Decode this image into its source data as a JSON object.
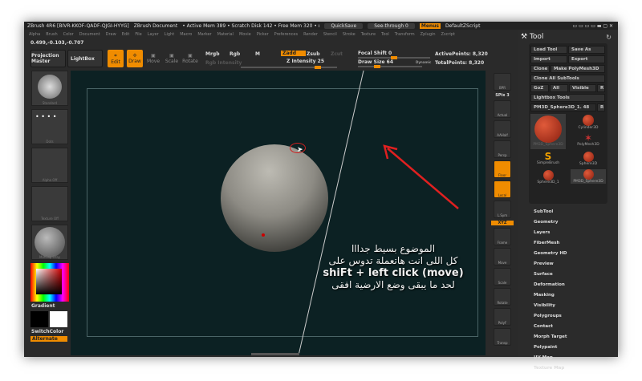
{
  "title": {
    "app": "ZBrush 4R6 [BIVR-KKOF-QADF-QJGI-HYYG]",
    "doc": "ZBrush Document",
    "mem": "• Active Mem 389 • Scratch Disk 142 • Free Mem 320 • ı",
    "quicksave": "QuickSave",
    "seethrough": "See-through 0",
    "menus": "Menus",
    "script": "DefaultZScript"
  },
  "menu": [
    "Alpha",
    "Brush",
    "Color",
    "Document",
    "Draw",
    "Edit",
    "File",
    "Layer",
    "Light",
    "Macro",
    "Marker",
    "Material",
    "Movie",
    "Picker",
    "Preferences",
    "Render",
    "Stencil",
    "Stroke",
    "Texture",
    "Tool",
    "Transform",
    "Zplugin",
    "Zscript"
  ],
  "coords": "0.499,-0.103,-0.707",
  "toolbar": {
    "projection": "Projection Master",
    "lightbox": "LightBox",
    "edit": "Edit",
    "draw": "Draw",
    "move": "Move",
    "scale": "Scale",
    "rotate": "Rotate",
    "mrgb": "Mrgb",
    "rgb": "Rgb",
    "m": "M",
    "rgb_intensity": "Rgb Intensity",
    "zadd": "Zadd",
    "zsub": "Zsub",
    "zcut": "Zcut",
    "z_intensity": "Z Intensity 25",
    "focal_shift": "Focal Shift 0",
    "draw_size": "Draw Size 64",
    "dynamic": "Dynamic",
    "active_points": "ActivePoints: 8,320",
    "total_points": "TotalPoints: 8,320"
  },
  "left": {
    "brush": "Standard",
    "stroke": "Dots",
    "alpha": "Alpha Off",
    "texture": "Texture Off",
    "material": "MatCap Gray",
    "gradient": "Gradient",
    "switch": "SwitchColor",
    "alternate": "Alternate"
  },
  "right_shelf": [
    "BPR",
    "SPix 3",
    "Actual",
    "AAHalf",
    "Persp",
    "Floor",
    "Local",
    "L.Sym",
    "XYZ",
    "Frame",
    "Move",
    "Scale",
    "Rotate",
    "PolyF",
    "Transp"
  ],
  "panel": {
    "title": "Tool",
    "load": "Load Tool",
    "save": "Save As",
    "import": "Import",
    "export": "Export",
    "clone": "Clone",
    "make_poly": "Make PolyMesh3D",
    "clone_all": "Clone All SubTools",
    "goz": "GoZ",
    "all": "All",
    "visible": "Visible",
    "r": "R",
    "lightbox_tools": "Lightbox Tools",
    "current": "PM3D_Sphere3D_1. 48",
    "tools": [
      "PM3D_Sphere3D",
      "Cylinder3D",
      "PolyMesh3D",
      "SimpleBrush",
      "Sphere3D",
      "Sphere3D_1",
      "PM3D_Sphere3D"
    ],
    "sections": [
      "SubTool",
      "Geometry",
      "Layers",
      "FiberMesh",
      "Geometry HD",
      "Preview",
      "Surface",
      "Deformation",
      "Masking",
      "Visibility",
      "Polygroups",
      "Contact",
      "Morph Target",
      "Polypaint",
      "UV Map",
      "Texture Map"
    ]
  },
  "overlay": [
    "الموضوع بسيط جدااا",
    "كل اللى انت هاتعملة تدوس على",
    "shiFt + left click (move)",
    "لحد ما يبقى وضع الارضية افقى"
  ],
  "colors": {
    "accent": "#f08c00",
    "canvas": "#0c2123"
  }
}
